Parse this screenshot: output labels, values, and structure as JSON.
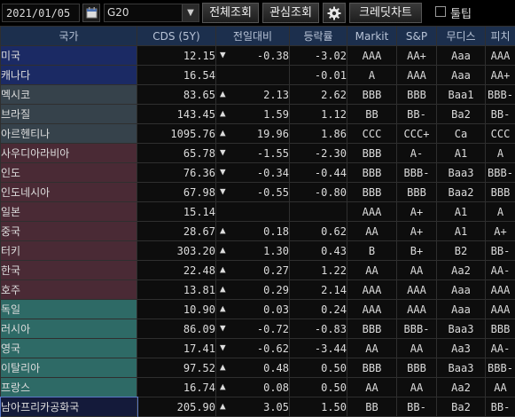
{
  "toolbar": {
    "date": "2021/01/05",
    "group": "G20",
    "btn_overall": "전체조회",
    "btn_favorite": "관심조회",
    "btn_credit_chart": "크레딧차트",
    "tooltip_label": "툴팁"
  },
  "columns": [
    "국가",
    "CDS (5Y)",
    "전일대비",
    "등락률",
    "Markit",
    "S&P",
    "무디스",
    "피치"
  ],
  "rows": [
    {
      "country": "미국",
      "cds": "12.15",
      "dir": "down",
      "change": "-0.38",
      "rate": "-3.02",
      "markit": "AAA",
      "sp": "AA+",
      "moodys": "Aaa",
      "fitch": "AAA",
      "color": "navy"
    },
    {
      "country": "캐나다",
      "cds": "16.54",
      "dir": "none",
      "change": "",
      "rate": "-0.01",
      "markit": "A",
      "sp": "AAA",
      "moodys": "Aaa",
      "fitch": "AA+",
      "color": "navy"
    },
    {
      "country": "멕시코",
      "cds": "83.65",
      "dir": "up",
      "change": "2.13",
      "rate": "2.62",
      "markit": "BBB",
      "sp": "BBB",
      "moodys": "Baa1",
      "fitch": "BBB-",
      "color": "slate"
    },
    {
      "country": "브라질",
      "cds": "143.45",
      "dir": "up",
      "change": "1.59",
      "rate": "1.12",
      "markit": "BB",
      "sp": "BB-",
      "moodys": "Ba2",
      "fitch": "BB-",
      "color": "slate"
    },
    {
      "country": "아르헨티나",
      "cds": "1095.76",
      "dir": "up",
      "change": "19.96",
      "rate": "1.86",
      "markit": "CCC",
      "sp": "CCC+",
      "moodys": "Ca",
      "fitch": "CCC",
      "color": "slate"
    },
    {
      "country": "사우디아라비아",
      "cds": "65.78",
      "dir": "down",
      "change": "-1.55",
      "rate": "-2.30",
      "markit": "BBB",
      "sp": "A-",
      "moodys": "A1",
      "fitch": "A",
      "color": "maroon"
    },
    {
      "country": "인도",
      "cds": "76.36",
      "dir": "down",
      "change": "-0.34",
      "rate": "-0.44",
      "markit": "BBB",
      "sp": "BBB-",
      "moodys": "Baa3",
      "fitch": "BBB-",
      "color": "maroon"
    },
    {
      "country": "인도네시아",
      "cds": "67.98",
      "dir": "down",
      "change": "-0.55",
      "rate": "-0.80",
      "markit": "BBB",
      "sp": "BBB",
      "moodys": "Baa2",
      "fitch": "BBB",
      "color": "maroon"
    },
    {
      "country": "일본",
      "cds": "15.14",
      "dir": "none",
      "change": "",
      "rate": "",
      "markit": "AAA",
      "sp": "A+",
      "moodys": "A1",
      "fitch": "A",
      "color": "maroon"
    },
    {
      "country": "중국",
      "cds": "28.67",
      "dir": "up",
      "change": "0.18",
      "rate": "0.62",
      "markit": "AA",
      "sp": "A+",
      "moodys": "A1",
      "fitch": "A+",
      "color": "maroon"
    },
    {
      "country": "터키",
      "cds": "303.20",
      "dir": "up",
      "change": "1.30",
      "rate": "0.43",
      "markit": "B",
      "sp": "B+",
      "moodys": "B2",
      "fitch": "BB-",
      "color": "maroon"
    },
    {
      "country": "한국",
      "cds": "22.48",
      "dir": "up",
      "change": "0.27",
      "rate": "1.22",
      "markit": "AA",
      "sp": "AA",
      "moodys": "Aa2",
      "fitch": "AA-",
      "color": "maroon"
    },
    {
      "country": "호주",
      "cds": "13.81",
      "dir": "up",
      "change": "0.29",
      "rate": "2.14",
      "markit": "AAA",
      "sp": "AAA",
      "moodys": "Aaa",
      "fitch": "AAA",
      "color": "maroon"
    },
    {
      "country": "독일",
      "cds": "10.90",
      "dir": "up",
      "change": "0.03",
      "rate": "0.24",
      "markit": "AAA",
      "sp": "AAA",
      "moodys": "Aaa",
      "fitch": "AAA",
      "color": "teal"
    },
    {
      "country": "러시아",
      "cds": "86.09",
      "dir": "down",
      "change": "-0.72",
      "rate": "-0.83",
      "markit": "BBB",
      "sp": "BBB-",
      "moodys": "Baa3",
      "fitch": "BBB",
      "color": "teal"
    },
    {
      "country": "영국",
      "cds": "17.41",
      "dir": "down",
      "change": "-0.62",
      "rate": "-3.44",
      "markit": "AA",
      "sp": "AA",
      "moodys": "Aa3",
      "fitch": "AA-",
      "color": "teal"
    },
    {
      "country": "이탈리아",
      "cds": "97.52",
      "dir": "up",
      "change": "0.48",
      "rate": "0.50",
      "markit": "BBB",
      "sp": "BBB",
      "moodys": "Baa3",
      "fitch": "BBB-",
      "color": "teal"
    },
    {
      "country": "프랑스",
      "cds": "16.74",
      "dir": "up",
      "change": "0.08",
      "rate": "0.50",
      "markit": "AA",
      "sp": "AA",
      "moodys": "Aa2",
      "fitch": "AA",
      "color": "teal"
    },
    {
      "country": "남아프리카공화국",
      "cds": "205.90",
      "dir": "up",
      "change": "3.05",
      "rate": "1.50",
      "markit": "BB",
      "sp": "BB-",
      "moodys": "Ba2",
      "fitch": "BB-",
      "color": "sel"
    }
  ]
}
